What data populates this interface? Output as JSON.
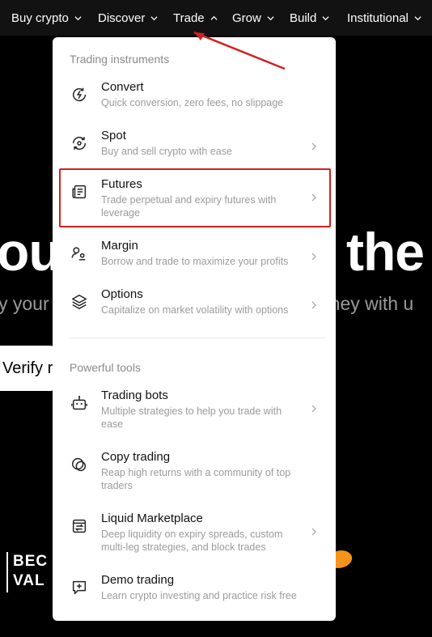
{
  "nav": {
    "items": [
      {
        "label": "Buy crypto",
        "open": false
      },
      {
        "label": "Discover",
        "open": false
      },
      {
        "label": "Trade",
        "open": true
      },
      {
        "label": "Grow",
        "open": false
      },
      {
        "label": "Build",
        "open": false
      },
      {
        "label": "Institutional",
        "open": false
      }
    ]
  },
  "background": {
    "hero_left": "ou",
    "hero_right": "the",
    "sub_left": "y your",
    "sub_right": "rney with u",
    "verify_label": "Verify r",
    "partner_logo_lines": [
      "BEC",
      "VAL"
    ]
  },
  "menu": {
    "trading_instruments_title": "Trading instruments",
    "trading_instruments": [
      {
        "title": "Convert",
        "desc": "Quick conversion, zero fees, no slippage",
        "icon": "convert-icon",
        "has_arrow": false
      },
      {
        "title": "Spot",
        "desc": "Buy and sell crypto with ease",
        "icon": "spot-icon",
        "has_arrow": true
      },
      {
        "title": "Futures",
        "desc": "Trade perpetual and expiry futures with leverage",
        "icon": "futures-icon",
        "has_arrow": true,
        "highlighted": true
      },
      {
        "title": "Margin",
        "desc": "Borrow and trade to maximize your profits",
        "icon": "margin-icon",
        "has_arrow": true
      },
      {
        "title": "Options",
        "desc": "Capitalize on market volatility with options",
        "icon": "options-icon",
        "has_arrow": true
      }
    ],
    "powerful_tools_title": "Powerful tools",
    "powerful_tools": [
      {
        "title": "Trading bots",
        "desc": "Multiple strategies to help you trade with ease",
        "icon": "bot-icon",
        "has_arrow": true
      },
      {
        "title": "Copy trading",
        "desc": "Reap high returns with a community of top traders",
        "icon": "copy-trading-icon",
        "has_arrow": false
      },
      {
        "title": "Liquid Marketplace",
        "desc": "Deep liquidity on expiry spreads, custom multi-leg strategies, and block trades",
        "icon": "marketplace-icon",
        "has_arrow": true
      },
      {
        "title": "Demo trading",
        "desc": "Learn crypto investing and practice risk free",
        "icon": "demo-trading-icon",
        "has_arrow": false
      }
    ]
  },
  "colors": {
    "nav_bg": "#121212",
    "menu_bg": "#ffffff",
    "annotation_red": "#d32020",
    "accent_orange": "#f7931a"
  }
}
